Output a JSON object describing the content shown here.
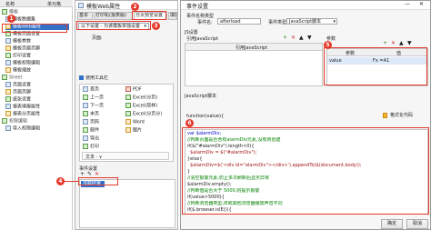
{
  "left_panel": {
    "col_headers": [
      "名称",
      "单元格"
    ],
    "items": [
      {
        "label": "模板",
        "kind": "header"
      },
      {
        "label": "模板数据集",
        "kind": "item"
      },
      {
        "label": "模板Web属性",
        "kind": "item"
      },
      {
        "label": "模板页面设置",
        "kind": "item"
      },
      {
        "label": "模板参数",
        "kind": "item"
      },
      {
        "label": "模板页眉页脚",
        "kind": "item"
      },
      {
        "label": "打印设置",
        "kind": "item"
      },
      {
        "label": "模板权限编辑",
        "kind": "item"
      },
      {
        "label": "模板缩放",
        "kind": "item"
      },
      {
        "label": "Sheet",
        "kind": "header"
      },
      {
        "label": "页面设置",
        "kind": "item"
      },
      {
        "label": "页眉页脚",
        "kind": "item"
      },
      {
        "label": "纸张设置",
        "kind": "item"
      },
      {
        "label": "报表填报属性",
        "kind": "item"
      },
      {
        "label": "报表分页属性",
        "kind": "item"
      },
      {
        "label": "权限编辑",
        "kind": "header"
      },
      {
        "label": "导入权限编辑",
        "kind": "item"
      }
    ]
  },
  "web_dialog": {
    "title": "模板Web属性",
    "tabs": [
      "基本",
      "打印机(报表版)",
      "分页预览设置",
      "填报页面设置"
    ],
    "active_tab": "分页预览设置",
    "dropdown_value": "以下设置 - 为该模板单独设置",
    "page_label": "页面:",
    "checkboxes": [
      {
        "label": "居左",
        "checked": false
      },
      {
        "label": "居中显示",
        "checked": true
      },
      {
        "label": "页面大小(填满)",
        "checked": false
      },
      {
        "label": "iframe嵌入时",
        "checked": false
      },
      {
        "label": "立即刷新加载",
        "checked": false
      },
      {
        "label": "自动加载",
        "checked": false
      }
    ],
    "toolbar_checkbox": "使用工具栏",
    "toolbar_items": [
      {
        "label": "首页",
        "icon": "first-page-icon"
      },
      {
        "label": "上一页",
        "icon": "prev-page-icon"
      },
      {
        "label": "下一页",
        "icon": "next-page-icon"
      },
      {
        "label": "末页",
        "icon": "last-page-icon"
      },
      {
        "label": "页码",
        "icon": "page-number-icon"
      },
      {
        "label": "邮件",
        "icon": "mail-icon"
      },
      {
        "label": "导出",
        "icon": "export-icon"
      },
      {
        "label": "打印",
        "icon": "print-icon"
      }
    ],
    "format_items": [
      {
        "label": "PDF",
        "icon": "pdf-icon"
      },
      {
        "label": "Excel(分页)",
        "icon": "excel-icon"
      },
      {
        "label": "Excel(原样)",
        "icon": "excel-icon"
      },
      {
        "label": "Excel(分页分)",
        "icon": "excel-icon"
      },
      {
        "label": "Word",
        "icon": "word-icon"
      },
      {
        "label": "图片",
        "icon": "image-icon"
      }
    ],
    "event_section_label": "事件设置",
    "event_item": "加载结束",
    "toolbar_row_text": "文本 ·  ∨"
  },
  "event_dialog": {
    "title": "事件设置",
    "name_label": "事件名称类型",
    "name_prefix": "事件名:",
    "name_value": "afterload",
    "type_label": "事件类型",
    "type_value": "JavaScript脚本",
    "js_label": "JS设置",
    "ref_label": "引用JavaScript",
    "ref_column": "引用JavaScript",
    "params_label": "参数",
    "param_headers": [
      "参数",
      "值"
    ],
    "param_row": {
      "name": "value",
      "value": "Fx =A1"
    },
    "js_script_label": "JavaScript脚本",
    "function_sig": "function(value){",
    "format_button": "格式化代码",
    "code_lines": [
      {
        "t": "var $alarmDiv;",
        "c": "kw"
      },
      {
        "t": "//判断页面是否含有alarmDiv元素,没有则创建",
        "c": "cm"
      },
      {
        "t": "if($(\"#alarmDiv\").length<0){",
        "c": ""
      },
      {
        "t": "  $alarmDiv = $(\"#alarmDiv\");",
        "c": "st"
      },
      {
        "t": "}else{",
        "c": ""
      },
      {
        "t": "  $alarmDiv=$('<div id=\"alarmDiv\"></div>').appendTo($(document.body));",
        "c": "st"
      },
      {
        "t": "}",
        "c": ""
      },
      {
        "t": "//清空报警元素,防止多次刷新后显示异常",
        "c": "cm"
      },
      {
        "t": "$alarmDiv.empty();",
        "c": ""
      },
      {
        "t": "//判断值是否大于 5000,则提示报警",
        "c": "cm"
      },
      {
        "t": "if(value>5000){",
        "c": ""
      },
      {
        "t": "//判断浏览器类型,IE和其他浏览器播放声音不同",
        "c": "cm"
      },
      {
        "t": "if($.browser.isIE()){",
        "c": ""
      }
    ],
    "ok_button": "确定",
    "cancel_button": "取消"
  },
  "badges": [
    "1",
    "2",
    "3",
    "4",
    "5",
    "6"
  ],
  "colors": {
    "annotation": "#e4392b",
    "selection": "#3470c7",
    "link_blue": "#0000cc"
  }
}
